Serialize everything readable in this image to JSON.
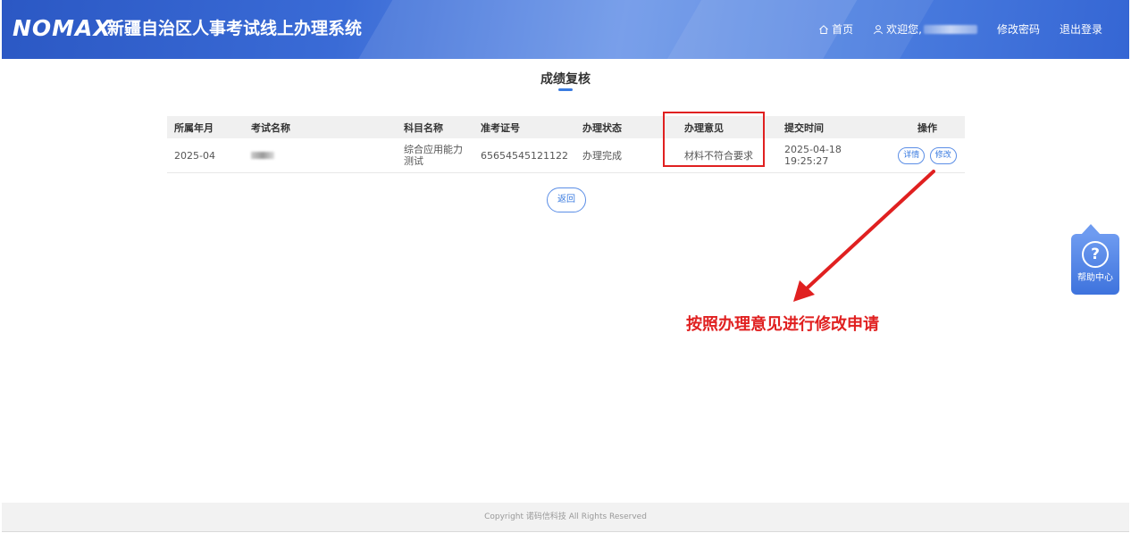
{
  "header": {
    "logo": "NOMAX",
    "system_title": "新疆自治区人事考试线上办理系统",
    "nav": {
      "home": "首页",
      "welcome": "欢迎您,",
      "change_password": "修改密码",
      "logout": "退出登录"
    }
  },
  "page": {
    "title": "成绩复核"
  },
  "table": {
    "headers": {
      "month": "所属年月",
      "exam": "考试名称",
      "subject": "科目名称",
      "ticket": "准考证号",
      "status": "办理状态",
      "opinion": "办理意见",
      "time": "提交时间",
      "ops": "操作"
    },
    "rows": [
      {
        "month": "2025-04",
        "exam": "",
        "subject": "综合应用能力测试",
        "ticket": "65654545121122",
        "status": "办理完成",
        "opinion": "材料不符合要求",
        "time": "2025-04-18 19:25:27",
        "detail_label": "详情",
        "modify_label": "修改"
      }
    ]
  },
  "back_label": "返回",
  "annotation": "按照办理意见进行修改申请",
  "help_label": "帮助中心",
  "footer": "Copyright 诺码信科技 All Rights Reserved",
  "colors": {
    "accent": "#3a7be0",
    "annotation": "#e02020",
    "header_start": "#2b58c4",
    "header_end": "#3566d4"
  },
  "icons": [
    "home-icon",
    "user-icon",
    "help-question-icon",
    "arrow-annotation"
  ]
}
